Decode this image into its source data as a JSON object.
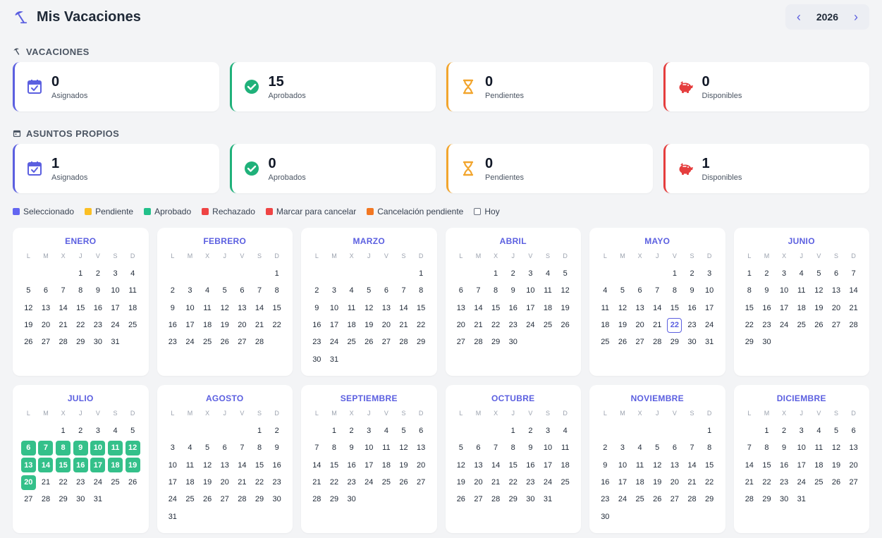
{
  "app": {
    "title": "Mis Vacaciones",
    "year": "2026"
  },
  "colors": {
    "accent": "#5b5fe0",
    "approved": "#34c08a",
    "pending": "#f2a52d",
    "rejected": "#e53e3e",
    "cancel_pending": "#f27722"
  },
  "vacaciones": {
    "label": "VACACIONES",
    "cards": [
      {
        "value": "0",
        "label": "Asignados",
        "icon": "calendar-check-icon",
        "color": "#5b5fe0"
      },
      {
        "value": "15",
        "label": "Aprobados",
        "icon": "check-circle-icon",
        "color": "#1fb17a"
      },
      {
        "value": "0",
        "label": "Pendientes",
        "icon": "hourglass-icon",
        "color": "#f2a52d"
      },
      {
        "value": "0",
        "label": "Disponibles",
        "icon": "piggy-bank-icon",
        "color": "#e53e3e"
      }
    ]
  },
  "asuntos": {
    "label": "ASUNTOS PROPIOS",
    "cards": [
      {
        "value": "1",
        "label": "Asignados",
        "icon": "calendar-check-icon",
        "color": "#5b5fe0"
      },
      {
        "value": "0",
        "label": "Aprobados",
        "icon": "check-circle-icon",
        "color": "#1fb17a"
      },
      {
        "value": "0",
        "label": "Pendientes",
        "icon": "hourglass-icon",
        "color": "#f2a52d"
      },
      {
        "value": "1",
        "label": "Disponibles",
        "icon": "piggy-bank-icon",
        "color": "#e53e3e"
      }
    ]
  },
  "legend": [
    {
      "label": "Seleccionado",
      "color": "#6366f1"
    },
    {
      "label": "Pendiente",
      "color": "#fbbf24"
    },
    {
      "label": "Aprobado",
      "color": "#22c08a"
    },
    {
      "label": "Rechazado",
      "color": "#ef4444"
    },
    {
      "label": "Marcar para cancelar",
      "color": "#ef4444"
    },
    {
      "label": "Cancelación pendiente",
      "color": "#f27722"
    },
    {
      "label": "Hoy",
      "color": "outline"
    }
  ],
  "weekdays": [
    "L",
    "M",
    "X",
    "J",
    "V",
    "S",
    "D"
  ],
  "months": [
    {
      "name": "ENERO",
      "offset": 3,
      "days": 31,
      "approved": [],
      "today": null
    },
    {
      "name": "FEBRERO",
      "offset": 6,
      "days": 28,
      "approved": [],
      "today": null
    },
    {
      "name": "MARZO",
      "offset": 6,
      "days": 31,
      "approved": [],
      "today": null
    },
    {
      "name": "ABRIL",
      "offset": 2,
      "days": 30,
      "approved": [],
      "today": null
    },
    {
      "name": "MAYO",
      "offset": 4,
      "days": 31,
      "approved": [],
      "today": 22
    },
    {
      "name": "JUNIO",
      "offset": 0,
      "days": 30,
      "approved": [],
      "today": null
    },
    {
      "name": "JULIO",
      "offset": 2,
      "days": 31,
      "approved": [
        6,
        7,
        8,
        9,
        10,
        11,
        12,
        13,
        14,
        15,
        16,
        17,
        18,
        19,
        20
      ],
      "today": null
    },
    {
      "name": "AGOSTO",
      "offset": 5,
      "days": 31,
      "approved": [],
      "today": null
    },
    {
      "name": "SEPTIEMBRE",
      "offset": 1,
      "days": 30,
      "approved": [],
      "today": null
    },
    {
      "name": "OCTUBRE",
      "offset": 3,
      "days": 31,
      "approved": [],
      "today": null
    },
    {
      "name": "NOVIEMBRE",
      "offset": 6,
      "days": 30,
      "approved": [],
      "today": null
    },
    {
      "name": "DICIEMBRE",
      "offset": 1,
      "days": 31,
      "approved": [],
      "today": null
    }
  ]
}
